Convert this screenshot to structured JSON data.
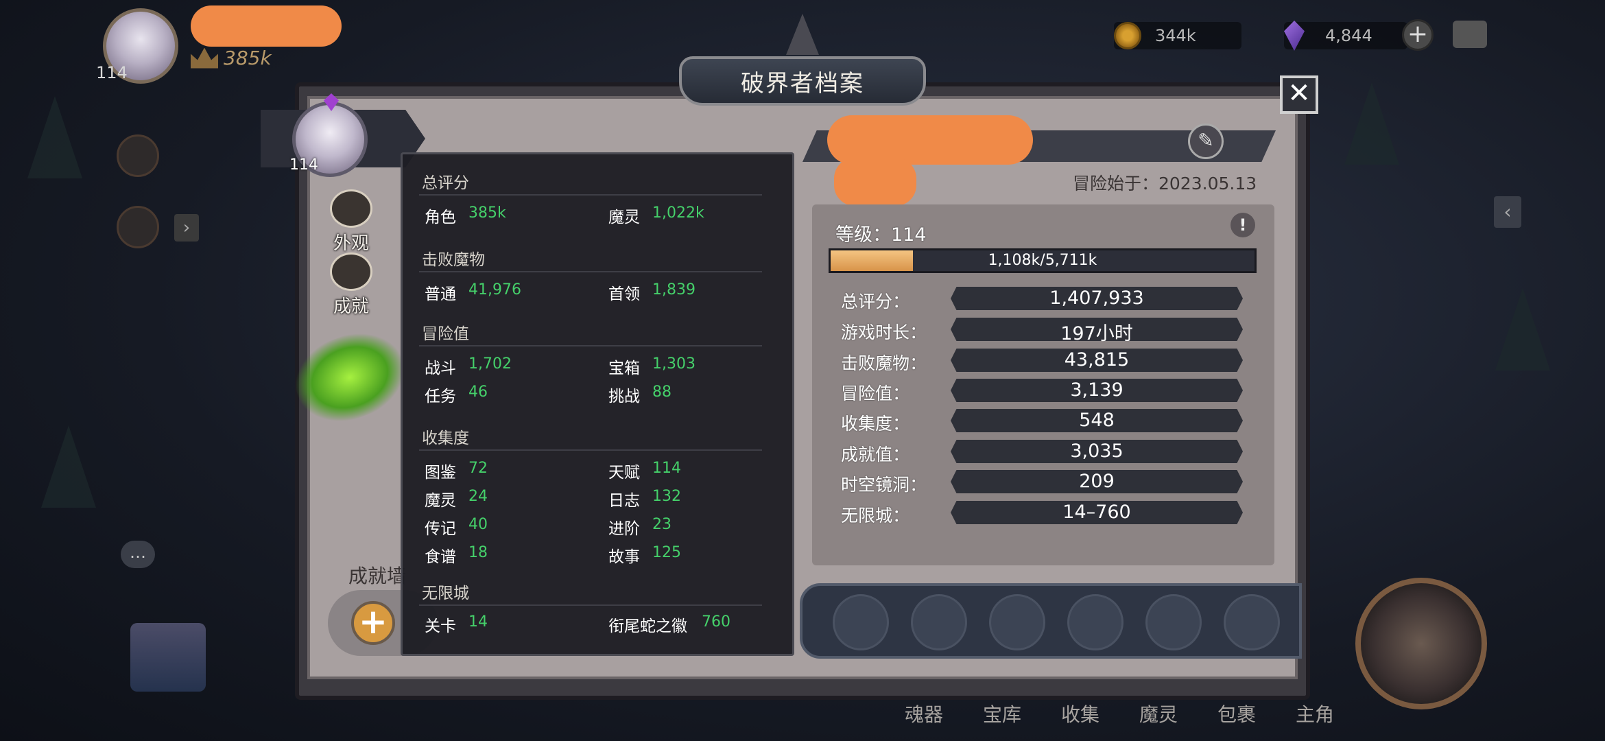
{
  "player": {
    "level": "114",
    "power": "385k"
  },
  "resources": {
    "gold": "344k",
    "gems": "4,844"
  },
  "panel": {
    "title": "破界者档案",
    "hero_level": "114",
    "tabs": [
      "外观",
      "成就"
    ],
    "achievement_wall_label": "成就墙"
  },
  "popup": {
    "sections": [
      {
        "title": "总评分",
        "rows": [
          [
            {
              "label": "角色",
              "value": "385k"
            },
            {
              "label": "魔灵",
              "value": "1,022k"
            }
          ]
        ]
      },
      {
        "title": "击败魔物",
        "rows": [
          [
            {
              "label": "普通",
              "value": "41,976"
            },
            {
              "label": "首领",
              "value": "1,839"
            }
          ]
        ]
      },
      {
        "title": "冒险值",
        "rows": [
          [
            {
              "label": "战斗",
              "value": "1,702"
            },
            {
              "label": "宝箱",
              "value": "1,303"
            }
          ],
          [
            {
              "label": "任务",
              "value": "46"
            },
            {
              "label": "挑战",
              "value": "88"
            }
          ]
        ]
      },
      {
        "title": "收集度",
        "rows": [
          [
            {
              "label": "图鉴",
              "value": "72"
            },
            {
              "label": "天赋",
              "value": "114"
            }
          ],
          [
            {
              "label": "魔灵",
              "value": "24"
            },
            {
              "label": "日志",
              "value": "132"
            }
          ],
          [
            {
              "label": "传记",
              "value": "40"
            },
            {
              "label": "进阶",
              "value": "23"
            }
          ],
          [
            {
              "label": "食谱",
              "value": "18"
            },
            {
              "label": "故事",
              "value": "125"
            }
          ]
        ]
      },
      {
        "title": "无限城",
        "rows": [
          [
            {
              "label": "关卡",
              "value": "14"
            },
            {
              "label": "衔尾蛇之徽",
              "value": "760"
            }
          ]
        ]
      }
    ]
  },
  "profile": {
    "start_date": "冒险始于：2023.05.13",
    "level_label": "等级：114",
    "xp_text": "1,108k/5,711k",
    "xp_fraction": 0.194,
    "stats": [
      {
        "label": "总评分：",
        "value": "1,407,933"
      },
      {
        "label": "游戏时长：",
        "value": "197小时"
      },
      {
        "label": "击败魔物：",
        "value": "43,815"
      },
      {
        "label": "冒险值：",
        "value": "3,139"
      },
      {
        "label": "收集度：",
        "value": "548"
      },
      {
        "label": "成就值：",
        "value": "3,035"
      },
      {
        "label": "时空镜洞：",
        "value": "209"
      },
      {
        "label": "无限城：",
        "value": "14–760"
      }
    ]
  },
  "bottom_nav": [
    "魂器",
    "宝库",
    "收集",
    "魔灵",
    "包裹",
    "主角"
  ],
  "colors": {
    "stat_green": "#45d06a",
    "xp_fill": "#e8a860",
    "redaction": "#f08a48"
  }
}
